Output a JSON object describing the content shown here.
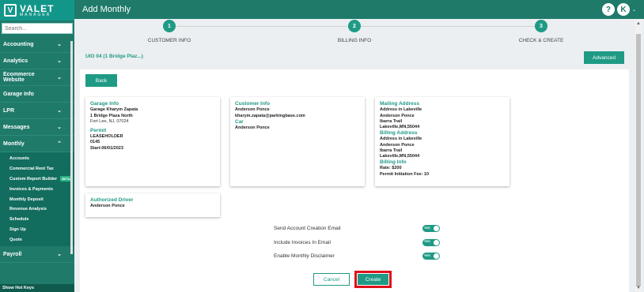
{
  "logo": {
    "title": "VALET",
    "subtitle": "MANAGER",
    "mark": "V"
  },
  "search": {
    "placeholder": "Search..."
  },
  "sidebar": {
    "items": [
      {
        "label": "Accounting",
        "chevron": "⌄"
      },
      {
        "label": "Analytics",
        "chevron": "⌄"
      },
      {
        "label": "Ecommerce Website",
        "chevron": "⌄"
      },
      {
        "label": "Garage Info",
        "chevron": ""
      },
      {
        "label": "LPR",
        "chevron": "⌄"
      },
      {
        "label": "Messages",
        "chevron": "⌄"
      },
      {
        "label": "Monthly",
        "chevron": "⌃"
      }
    ],
    "submenu": [
      "Accounts",
      "Commercial Rent Tax",
      "Custom Report Builder",
      "Invoices & Payments",
      "Monthly Deposit",
      "Revenue Analysis",
      "Schedule",
      "Sign Up",
      "Quote"
    ],
    "beta_badge": "BETA",
    "payroll": {
      "label": "Payroll",
      "chevron": "⌄"
    },
    "hotkeys": "Show Hot Keys"
  },
  "header": {
    "title": "Add Monthly",
    "help": "?",
    "avatar": "K",
    "caret": "⌄"
  },
  "stepper": {
    "steps": [
      {
        "num": "1",
        "label": "CUSTOMER INFO"
      },
      {
        "num": "2",
        "label": "BILLING INFO"
      },
      {
        "num": "3",
        "label": "CHECK & CREATE"
      }
    ]
  },
  "lot_label": "UIO 04 (1 Bridge Plaz...)",
  "buttons": {
    "advanced": "Advanced",
    "back": "Back",
    "cancel": "Cancel",
    "create": "Create"
  },
  "garage_card": {
    "title": "Garage Info",
    "name": "Garage Kharym Zapata",
    "street": "1 Bridge Plaza North",
    "city": "Fort Lee, NJ, 07024",
    "permit_title": "Permit",
    "permit_type": "LEASEHOLDER",
    "permit_num": "0145",
    "start": "Start:06/01/2023"
  },
  "customer_card": {
    "title": "Customer Info",
    "name": "Anderson Ponce",
    "email": "kharym.zapata@parkingbase.com",
    "car_title": "Car",
    "car_value": "Anderson Ponce"
  },
  "address_card": {
    "mail_title": "Mailing Address",
    "mail_lines": [
      "Address in Lakeville",
      "Anderson Ponce",
      "Ibarra Trail",
      "Lakeville,MN,55044"
    ],
    "bill_title": "Billing Address",
    "bill_lines": [
      "Address in Lakeville",
      "Anderson Ponce",
      "Ibarra Trail",
      "Lakeville,MN,55044"
    ],
    "info_title": "Billing Info",
    "rate": "Rate: $200",
    "fee": "Permit Initiation Fee: 10"
  },
  "driver_card": {
    "title": "Authorized Driver",
    "name": "Anderson Ponce"
  },
  "options": [
    {
      "label": "Send Account Creation Email",
      "toggle": "YES"
    },
    {
      "label": "Include Invoices In Email",
      "toggle": "YES"
    },
    {
      "label": "Enable Monthly Disclaimer",
      "toggle": "YES"
    }
  ],
  "colors": {
    "brand": "#1f7a6a",
    "accent": "#1f9a85",
    "highlight": "#e0101a"
  }
}
